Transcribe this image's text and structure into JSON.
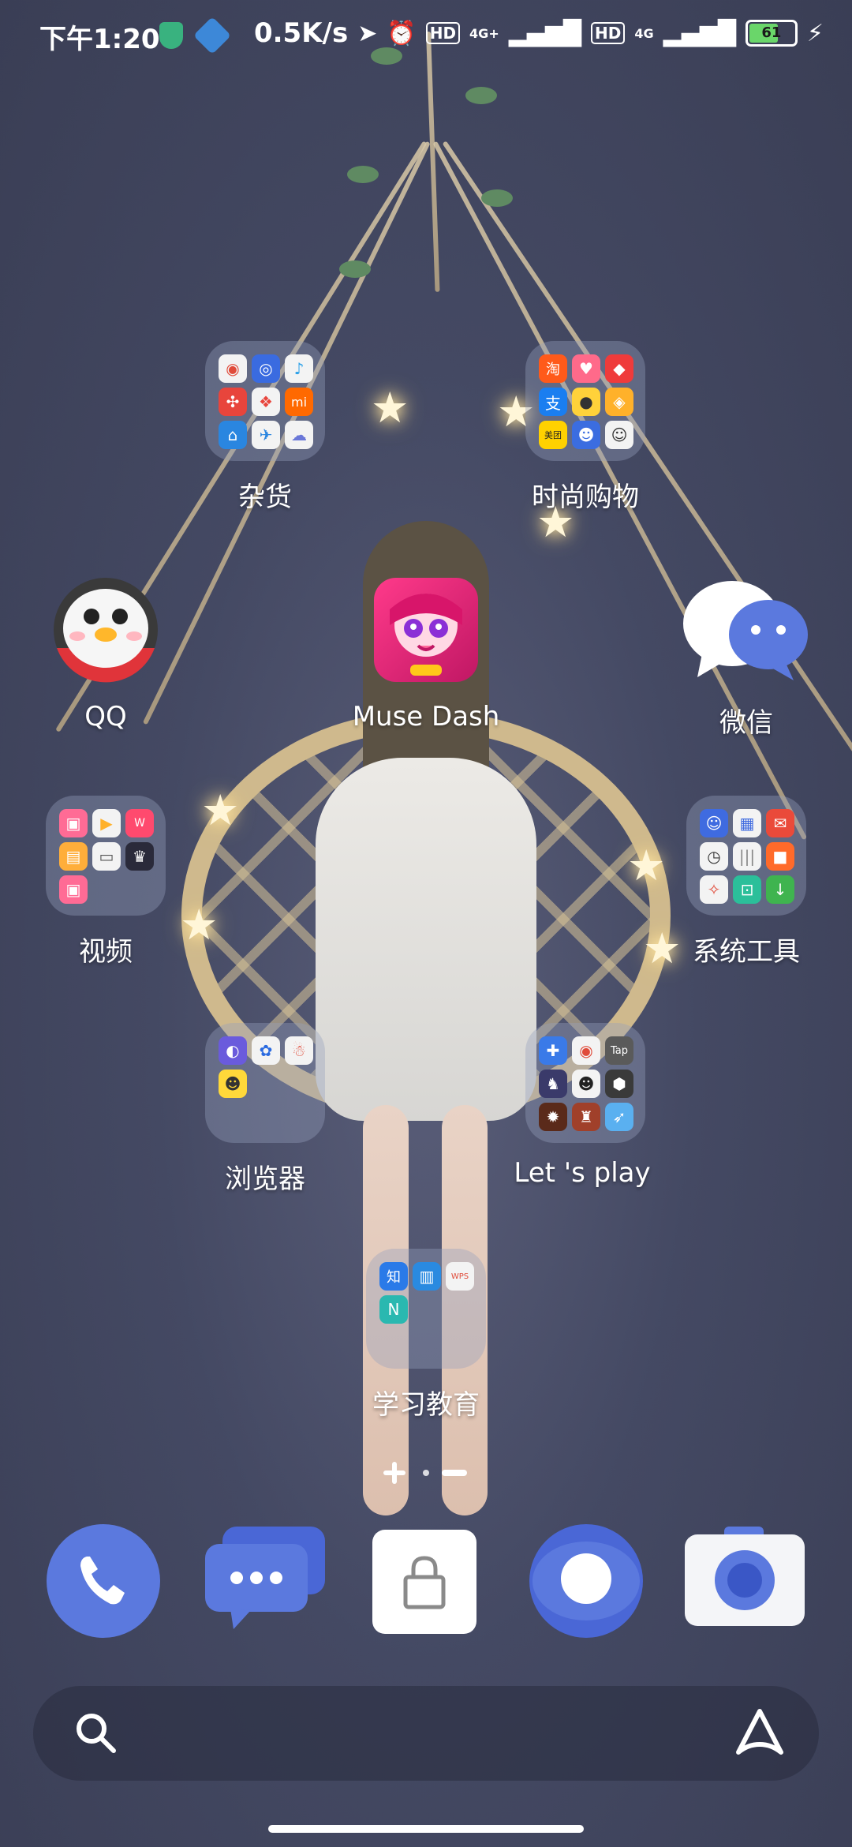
{
  "status_bar": {
    "time": "下午1:20",
    "net_speed": "0.5K/s",
    "hd1": "HD",
    "hd2": "HD",
    "sig1": "4G+",
    "sig2": "4G",
    "battery": "61"
  },
  "home": {
    "folders": {
      "misc": "杂货",
      "shopping": "时尚购物",
      "video": "视频",
      "tools": "系统工具",
      "browser": "浏览器",
      "play": "Let 's  play",
      "education": "学习教育"
    },
    "apps": {
      "qq": "QQ",
      "musedash": "Muse Dash",
      "wechat": "微信"
    },
    "mini_text": {
      "taobao": "淘",
      "mi": "mi",
      "meituan": "美团",
      "tap": "Tap",
      "zhi": "知",
      "n": "N",
      "wps": "WPS"
    },
    "page_indicator": "+ • —"
  },
  "colors": {
    "accent": "#4f6fdc",
    "dock_blue": "#5b79de"
  }
}
